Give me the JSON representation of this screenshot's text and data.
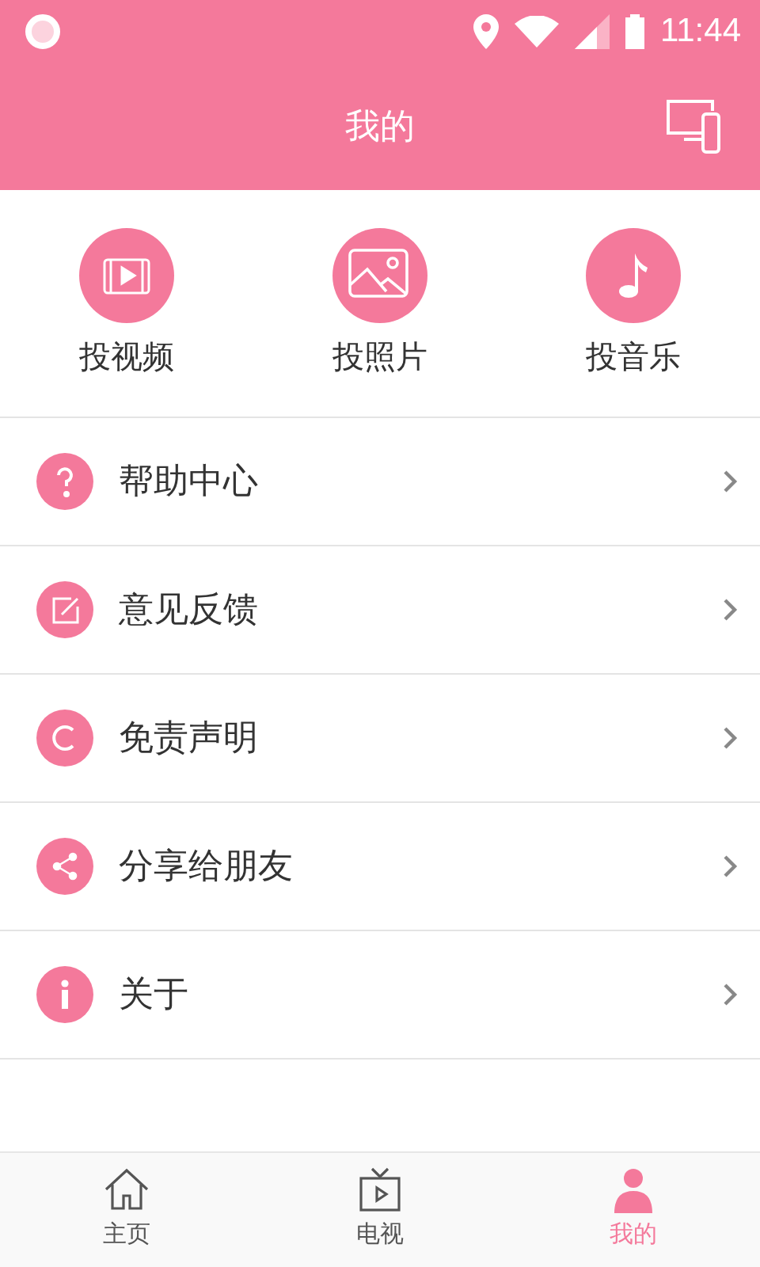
{
  "status_bar": {
    "time": "11:44"
  },
  "header": {
    "title": "我的"
  },
  "actions": [
    {
      "label": "投视频"
    },
    {
      "label": "投照片"
    },
    {
      "label": "投音乐"
    }
  ],
  "menu": [
    {
      "label": "帮助中心"
    },
    {
      "label": "意见反馈"
    },
    {
      "label": "免责声明"
    },
    {
      "label": "分享给朋友"
    },
    {
      "label": "关于"
    }
  ],
  "tabs": [
    {
      "label": "主页",
      "selected": false
    },
    {
      "label": "电视",
      "selected": false
    },
    {
      "label": "我的",
      "selected": true
    }
  ]
}
